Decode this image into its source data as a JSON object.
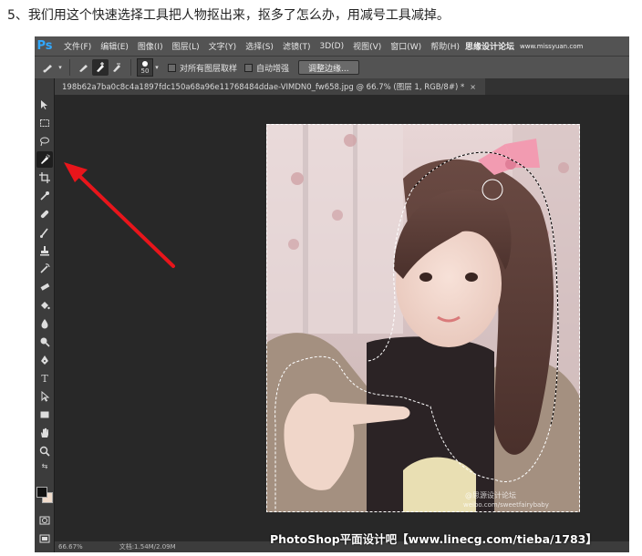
{
  "caption": "5、我们用这个快速选择工具把人物抠出来，抠多了怎么办，用减号工具减掉。",
  "app": {
    "logo": "Ps",
    "menu": [
      "文件(F)",
      "编辑(E)",
      "图像(I)",
      "图层(L)",
      "文字(Y)",
      "选择(S)",
      "滤镜(T)",
      "3D(D)",
      "视图(V)",
      "窗口(W)",
      "帮助(H)"
    ],
    "menu_watermark": "思缘设计论坛",
    "menu_watermark_url": "www.missyuan.com"
  },
  "options_bar": {
    "brush_size": "50",
    "sample_all_layers": "对所有图层取样",
    "auto_enhance": "自动增强",
    "refine_edge_button": "调整边缘..."
  },
  "document_tab": {
    "title": "198b62a7ba0c8c4a1897fdc150a68a96e11768484ddae-VIMDN0_fw658.jpg @ 66.7% (图层 1, RGB/8#) *",
    "close": "×"
  },
  "toolbar": {
    "active_tool": "quick-selection",
    "tools": [
      "move",
      "marquee",
      "lasso",
      "quick-selection",
      "crop",
      "eyedropper",
      "healing",
      "brush",
      "clone-stamp",
      "history-brush",
      "eraser",
      "paint-bucket",
      "blur",
      "dodge",
      "pen",
      "type",
      "path-selection",
      "rectangle",
      "hand",
      "zoom"
    ],
    "foreground_color": "#111111",
    "background_color": "#f0dccc"
  },
  "status_bar": {
    "zoom": "66.67%",
    "doc_info": "文档:1.54M/2.09M"
  },
  "photo_watermark": {
    "line1": "@思源设计论坛",
    "line2": "weibo.com/sweetfairybaby"
  },
  "bottom_watermark": "PhotoShop平面设计吧【www.linecg.com/tieba/1783】",
  "colors": {
    "arrow": "#e8151b",
    "ps_blue": "#31a8ff",
    "bow": "#f29bb1"
  }
}
